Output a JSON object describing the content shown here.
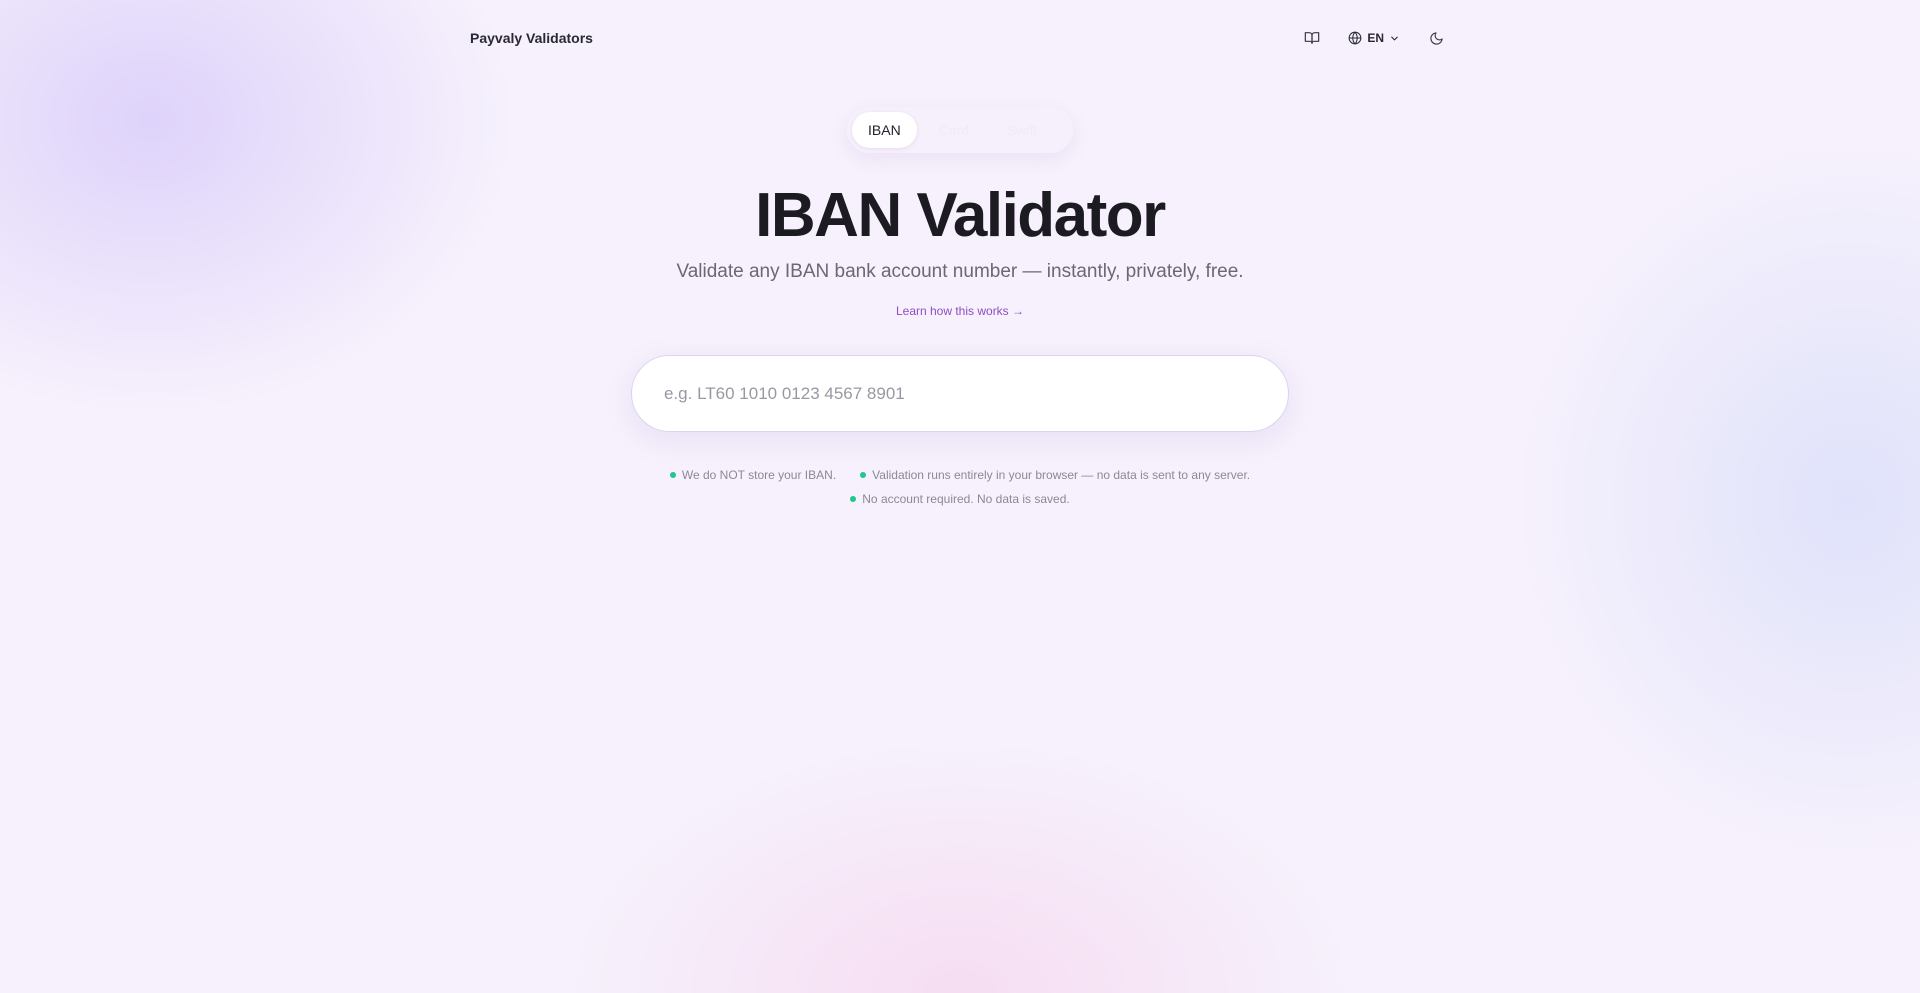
{
  "header": {
    "brand": "Payvaly Validators",
    "docs_icon": "book-open-icon",
    "language": {
      "icon": "globe-icon",
      "label": "EN",
      "chevron": "chevron-down-icon"
    },
    "theme_icon": "moon-icon"
  },
  "tabs": [
    {
      "label": "IBAN",
      "active": true
    },
    {
      "label": "Card",
      "active": false
    },
    {
      "label": "Swift",
      "active": false
    }
  ],
  "hero": {
    "title": "IBAN Validator",
    "subtitle": "Validate any IBAN bank account number — instantly, privately, free.",
    "learn_link": "Learn how this works →"
  },
  "search": {
    "value": "",
    "placeholder": "e.g. LT60 1010 0123 4567 8901"
  },
  "notes": {
    "items": [
      "We do NOT store your IBAN.",
      "Validation runs entirely in your browser — no data is sent to any server.",
      "No account required. No data is saved."
    ],
    "dot_color": "#22c58b"
  },
  "colors": {
    "accent": "#8b4fc4",
    "background": "#f6f1fc"
  }
}
